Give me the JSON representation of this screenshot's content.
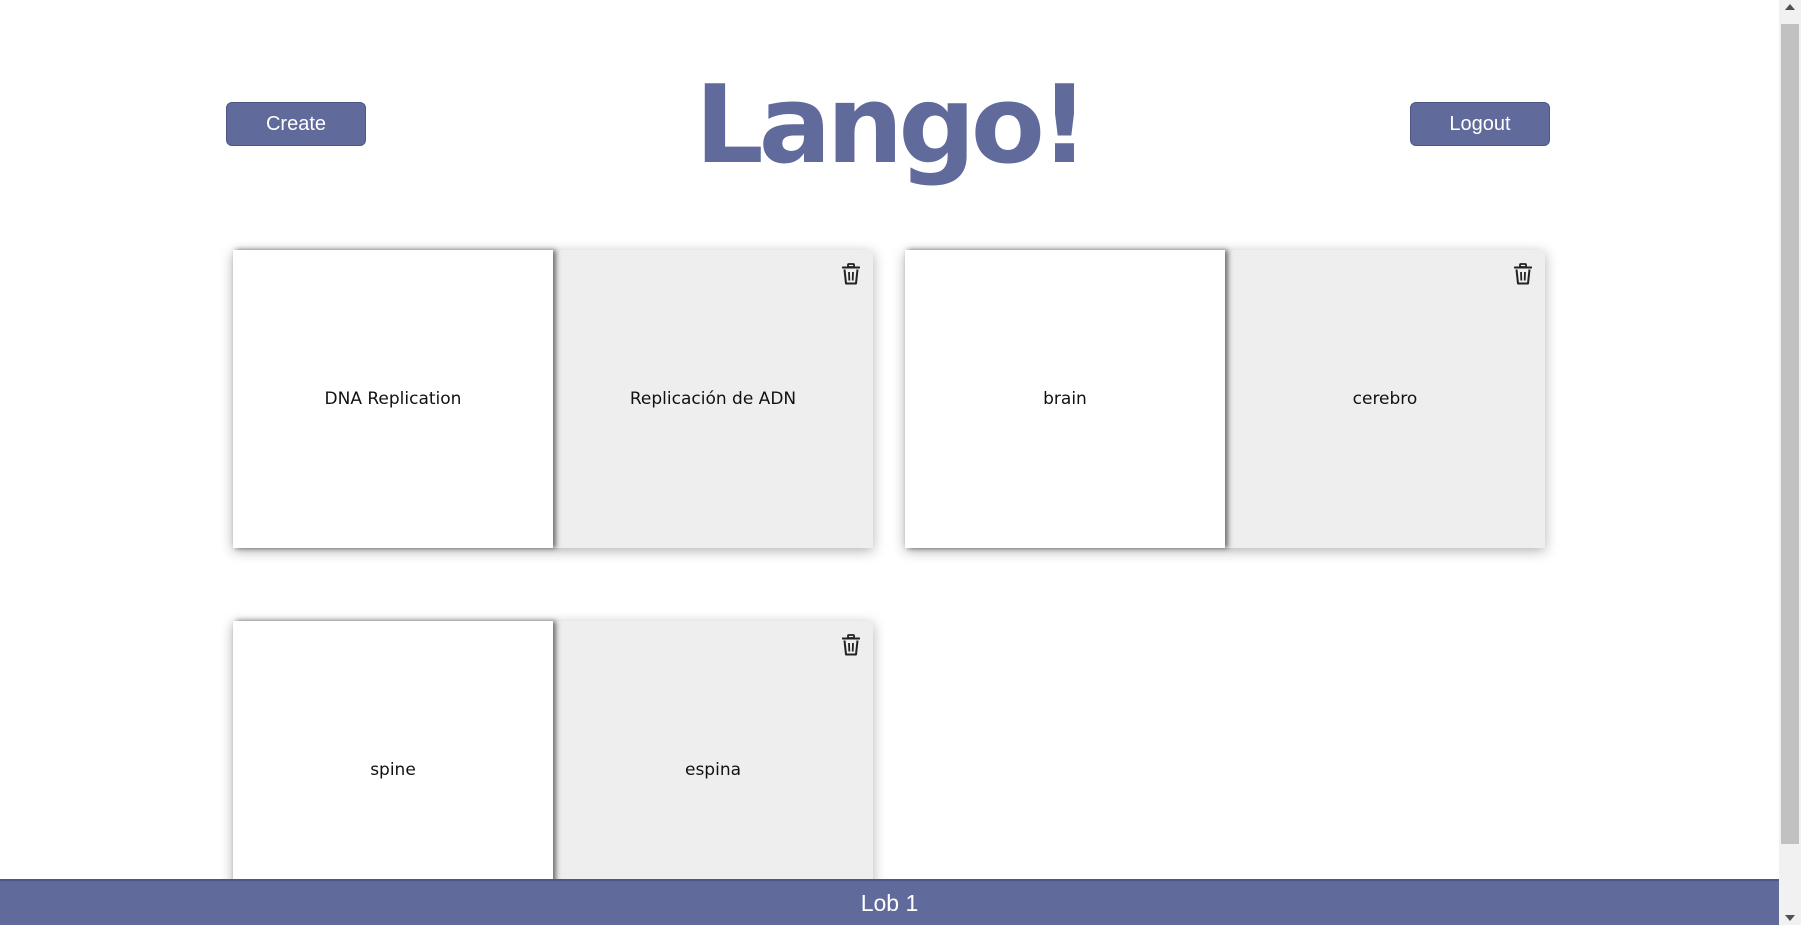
{
  "header": {
    "create_label": "Create",
    "logo_text": "Lango!",
    "logout_label": "Logout"
  },
  "cards": [
    {
      "front": "DNA Replication",
      "back": "Replicación de ADN",
      "delete_icon": "trash-icon"
    },
    {
      "front": "brain",
      "back": "cerebro",
      "delete_icon": "trash-icon"
    },
    {
      "front": "spine",
      "back": "espina",
      "delete_icon": "trash-icon"
    }
  ],
  "footer": {
    "text": "Lob 1"
  },
  "colors": {
    "brand": "#606a9b",
    "card_back": "#eeeeee",
    "card_front": "#ffffff"
  }
}
